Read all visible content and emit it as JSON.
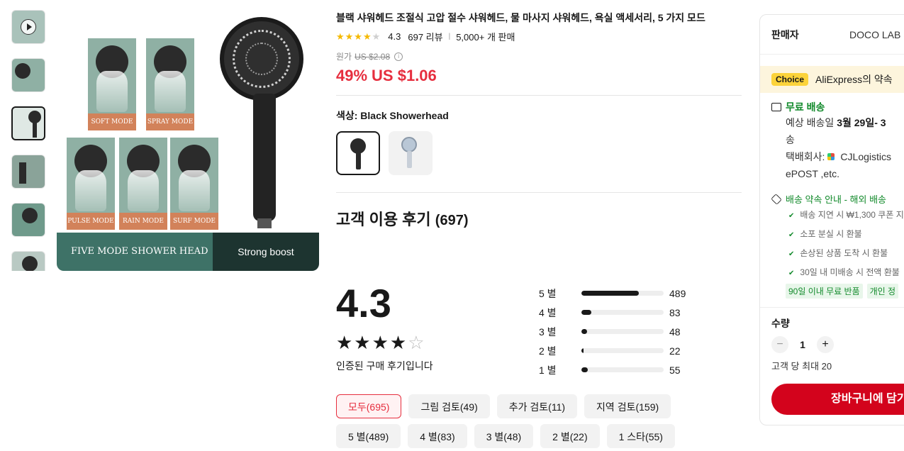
{
  "product": {
    "title": "블랙 샤워헤드 조절식 고압 절수 샤워헤드, 물 마사지 샤워헤드, 욕실 액세서리, 5 가지 모드",
    "rating": "4.3",
    "review_count": "697 리뷰",
    "sold": "5,000+ 개 판매",
    "orig_label": "원가",
    "orig_price": "US $2.08",
    "discount": "49%",
    "price": "US $1.06",
    "color_label": "색상: Black Showerhead"
  },
  "image_text": {
    "soft": "SOFT MODE",
    "spray": "SPRAY MODE",
    "pulse": "PULSE MODE",
    "rain": "RAIN MODE",
    "surf": "SURF MODE",
    "banner_left": "FIVE MODE SHOWER HEAD",
    "banner_right": "Strong boost"
  },
  "reviews": {
    "heading": "고객 이용 후기",
    "count": "(697)",
    "score": "4.3",
    "verified": "인증된 구매 후기입니다",
    "distribution": [
      {
        "label": "5 별",
        "count": "489",
        "fraction": 0.7
      },
      {
        "label": "4 별",
        "count": "83",
        "fraction": 0.12
      },
      {
        "label": "3 별",
        "count": "48",
        "fraction": 0.07
      },
      {
        "label": "2 별",
        "count": "22",
        "fraction": 0.03
      },
      {
        "label": "1 별",
        "count": "55",
        "fraction": 0.08
      }
    ],
    "filters_row1": [
      "모두(695)",
      "그림 검토(49)",
      "추가 검토(11)",
      "지역 검토(159)"
    ],
    "filters_row2": [
      "5 별(489)",
      "4 별(83)",
      "3 별(48)",
      "2 별(22)",
      "1 스타(55)"
    ]
  },
  "side": {
    "seller_label": "판매자",
    "seller_value": "DOCO LAB S",
    "choice_badge": "Choice",
    "choice_text": "AliExpress의 약속",
    "free_shipping": "무료 배송",
    "eta_prefix": "예상 배송일",
    "eta_date": "3월 29일- 3",
    "eta_suffix": "송",
    "courier": "택배회사:",
    "courier_name": "CJLogistics",
    "courier_more": "ePOST ,etc.",
    "promise_title": "배송 약속 안내 - 해외 배송",
    "promises": [
      "배송 지연 시 ₩1,300 쿠폰 지",
      "소포 분실 시 환불",
      "손상된 상품 도착 시 환불",
      "30일 내 미배송 시 전액 환불"
    ],
    "tags": [
      "90일 이내 무료 반품",
      "개인 정"
    ],
    "qty_label": "수량",
    "qty_minus": "−",
    "qty_value": "1",
    "qty_plus": "+",
    "limit": "고객 당 최대 20",
    "cart": "장바구니에 담기"
  },
  "colors": {
    "price": "#e62e3e",
    "choice": "#fcd33a",
    "green": "#128a2b",
    "cart": "#d3031c"
  }
}
